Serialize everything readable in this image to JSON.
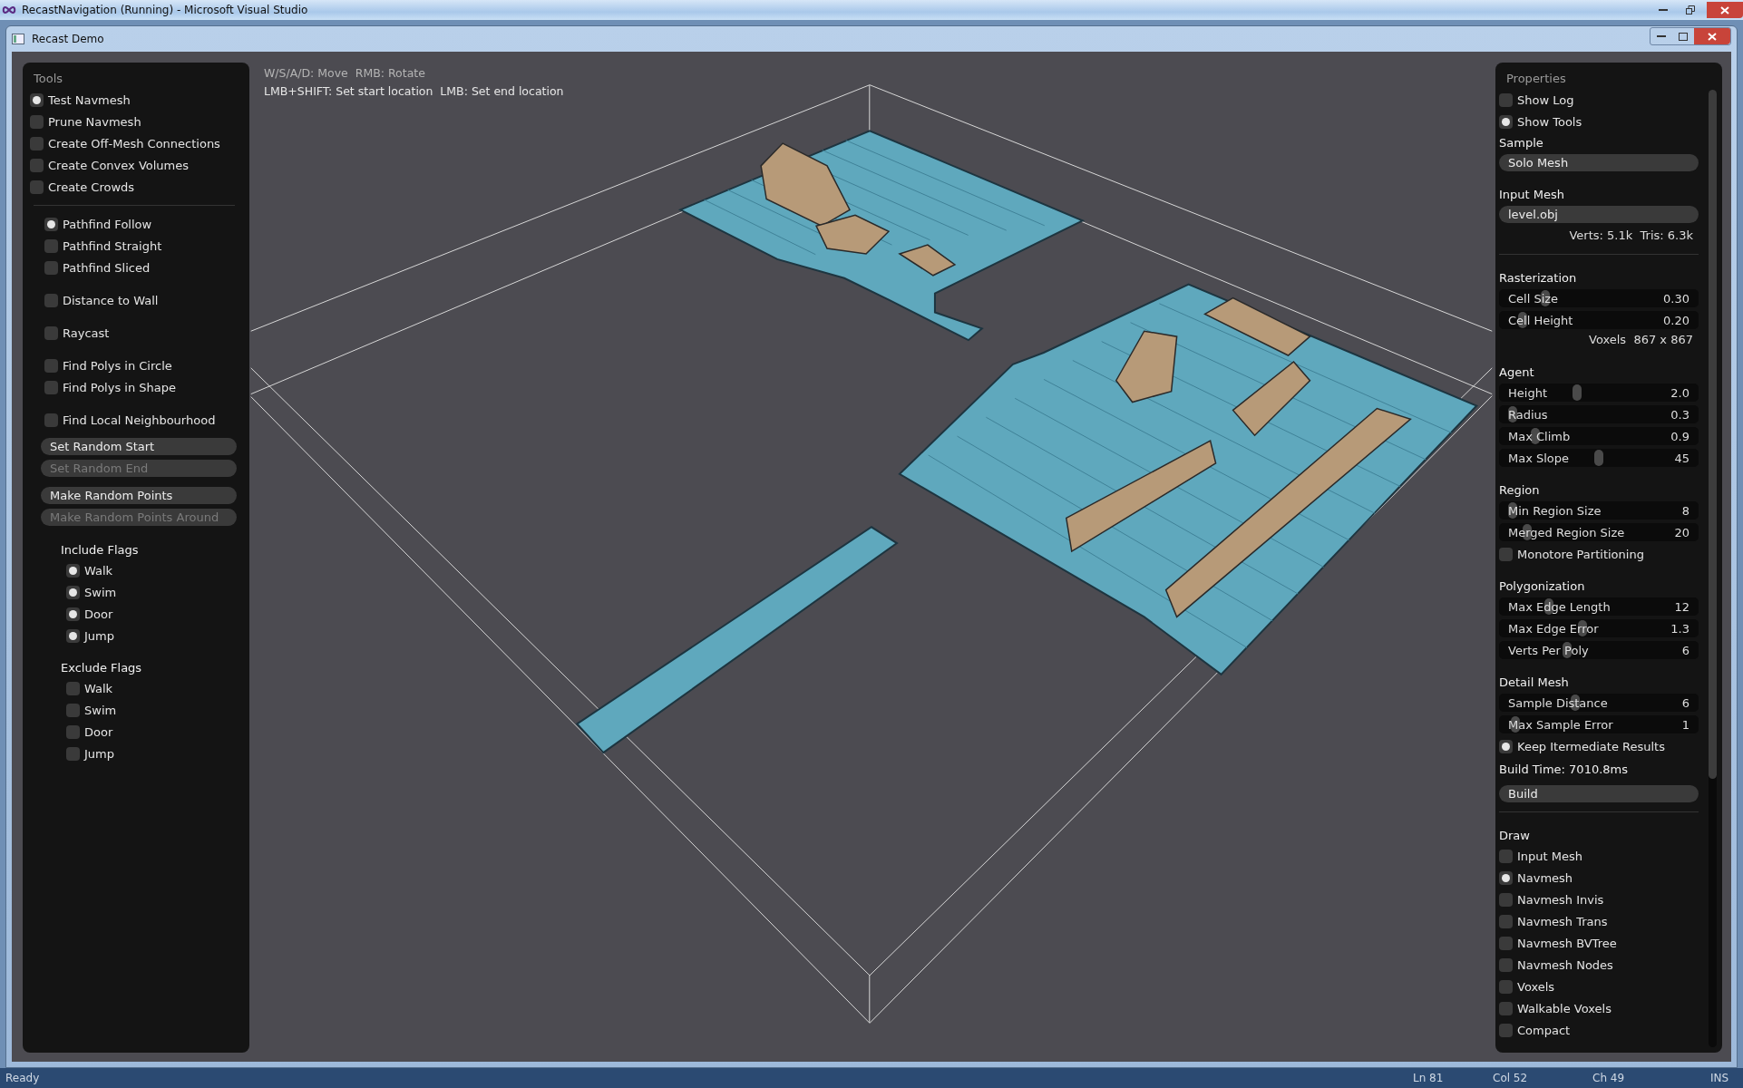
{
  "vs_window": {
    "title": "RecastNavigation (Running) - Microsoft Visual Studio"
  },
  "demo_window": {
    "title": "Recast Demo"
  },
  "hints": [
    "W/S/A/D: Move  RMB: Rotate",
    "LMB+SHIFT: Set start location  LMB: Set end location"
  ],
  "tools": {
    "title": "Tools",
    "items": [
      {
        "label": "Test Navmesh",
        "checked": true
      },
      {
        "label": "Prune Navmesh",
        "checked": false
      },
      {
        "label": "Create Off-Mesh Connections",
        "checked": false
      },
      {
        "label": "Create Convex Volumes",
        "checked": false
      },
      {
        "label": "Create Crowds",
        "checked": false
      }
    ]
  },
  "tool_options": [
    [
      {
        "kind": "check",
        "label": "Pathfind Follow",
        "checked": true
      },
      {
        "kind": "check",
        "label": "Pathfind Straight",
        "checked": false
      },
      {
        "kind": "check",
        "label": "Pathfind Sliced",
        "checked": false
      }
    ],
    [
      {
        "kind": "check",
        "label": "Distance to Wall",
        "checked": false
      }
    ],
    [
      {
        "kind": "check",
        "label": "Raycast",
        "checked": false
      }
    ],
    [
      {
        "kind": "check",
        "label": "Find Polys in Circle",
        "checked": false
      },
      {
        "kind": "check",
        "label": "Find Polys in Shape",
        "checked": false
      }
    ],
    [
      {
        "kind": "check",
        "label": "Find Local Neighbourhood",
        "checked": false
      }
    ],
    [
      {
        "kind": "button",
        "label": "Set Random Start",
        "disabled": false
      },
      {
        "kind": "button",
        "label": "Set Random End",
        "disabled": true
      }
    ],
    [
      {
        "kind": "button",
        "label": "Make Random Points",
        "disabled": false
      },
      {
        "kind": "button",
        "label": "Make Random Points Around",
        "disabled": true
      }
    ]
  ],
  "include_flags": {
    "title": "Include Flags",
    "items": [
      {
        "label": "Walk",
        "checked": true
      },
      {
        "label": "Swim",
        "checked": true
      },
      {
        "label": "Door",
        "checked": true
      },
      {
        "label": "Jump",
        "checked": true
      }
    ]
  },
  "exclude_flags": {
    "title": "Exclude Flags",
    "items": [
      {
        "label": "Walk",
        "checked": false
      },
      {
        "label": "Swim",
        "checked": false
      },
      {
        "label": "Door",
        "checked": false
      },
      {
        "label": "Jump",
        "checked": false
      }
    ]
  },
  "properties": {
    "title": "Properties",
    "items": [
      {
        "kind": "check",
        "label": "Show Log",
        "checked": false
      },
      {
        "kind": "check",
        "label": "Show Tools",
        "checked": true
      },
      {
        "kind": "heading",
        "label": "Sample"
      },
      {
        "kind": "button",
        "label": "Solo Mesh"
      },
      {
        "kind": "heading",
        "label": "Input Mesh"
      },
      {
        "kind": "button",
        "label": "level.obj"
      },
      {
        "kind": "info",
        "label": "Verts: 5.1k  Tris: 6.3k"
      },
      {
        "kind": "divider"
      },
      {
        "kind": "heading",
        "label": "Rasterization"
      },
      {
        "kind": "slider",
        "label": "Cell Size",
        "value": "0.30",
        "level": 0.23
      },
      {
        "kind": "slider",
        "label": "Cell Height",
        "value": "0.20",
        "level": 0.12
      },
      {
        "kind": "info",
        "label": "Voxels  867 x 867"
      },
      {
        "kind": "heading",
        "label": "Agent"
      },
      {
        "kind": "slider",
        "label": "Height",
        "value": "2.0",
        "level": 0.39
      },
      {
        "kind": "slider",
        "label": "Radius",
        "value": "0.3",
        "level": 0.07
      },
      {
        "kind": "slider",
        "label": "Max Climb",
        "value": "0.9",
        "level": 0.18
      },
      {
        "kind": "slider",
        "label": "Max Slope",
        "value": "45",
        "level": 0.5
      },
      {
        "kind": "heading",
        "label": "Region"
      },
      {
        "kind": "slider",
        "label": "Min Region Size",
        "value": "8",
        "level": 0.07
      },
      {
        "kind": "slider",
        "label": "Merged Region Size",
        "value": "20",
        "level": 0.14
      },
      {
        "kind": "check",
        "label": "Monotore Partitioning",
        "checked": false
      },
      {
        "kind": "heading",
        "label": "Polygonization"
      },
      {
        "kind": "slider",
        "label": "Max Edge Length",
        "value": "12",
        "level": 0.25
      },
      {
        "kind": "slider",
        "label": "Max Edge Error",
        "value": "1.3",
        "level": 0.42
      },
      {
        "kind": "slider",
        "label": "Verts Per Poly",
        "value": "6",
        "level": 0.34
      },
      {
        "kind": "heading",
        "label": "Detail Mesh"
      },
      {
        "kind": "slider",
        "label": "Sample Distance",
        "value": "6",
        "level": 0.38
      },
      {
        "kind": "slider",
        "label": "Max Sample Error",
        "value": "1",
        "level": 0.08
      },
      {
        "kind": "check",
        "label": "Keep Itermediate Results",
        "checked": true
      },
      {
        "kind": "label",
        "label": "Build Time: 7010.8ms"
      },
      {
        "kind": "button",
        "label": "Build"
      },
      {
        "kind": "divider"
      },
      {
        "kind": "heading",
        "label": "Draw"
      },
      {
        "kind": "check",
        "label": "Input Mesh",
        "checked": false
      },
      {
        "kind": "check",
        "label": "Navmesh",
        "checked": true
      },
      {
        "kind": "check",
        "label": "Navmesh Invis",
        "checked": false
      },
      {
        "kind": "check",
        "label": "Navmesh Trans",
        "checked": false
      },
      {
        "kind": "check",
        "label": "Navmesh BVTree",
        "checked": false
      },
      {
        "kind": "check",
        "label": "Navmesh Nodes",
        "checked": false
      },
      {
        "kind": "check",
        "label": "Voxels",
        "checked": false
      },
      {
        "kind": "check",
        "label": "Walkable Voxels",
        "checked": false
      },
      {
        "kind": "check",
        "label": "Compact",
        "checked": false
      }
    ]
  },
  "status_bar": {
    "message": "Ready",
    "fields": [
      "Ln 81",
      "Col 52",
      "Ch 49",
      "INS"
    ]
  }
}
